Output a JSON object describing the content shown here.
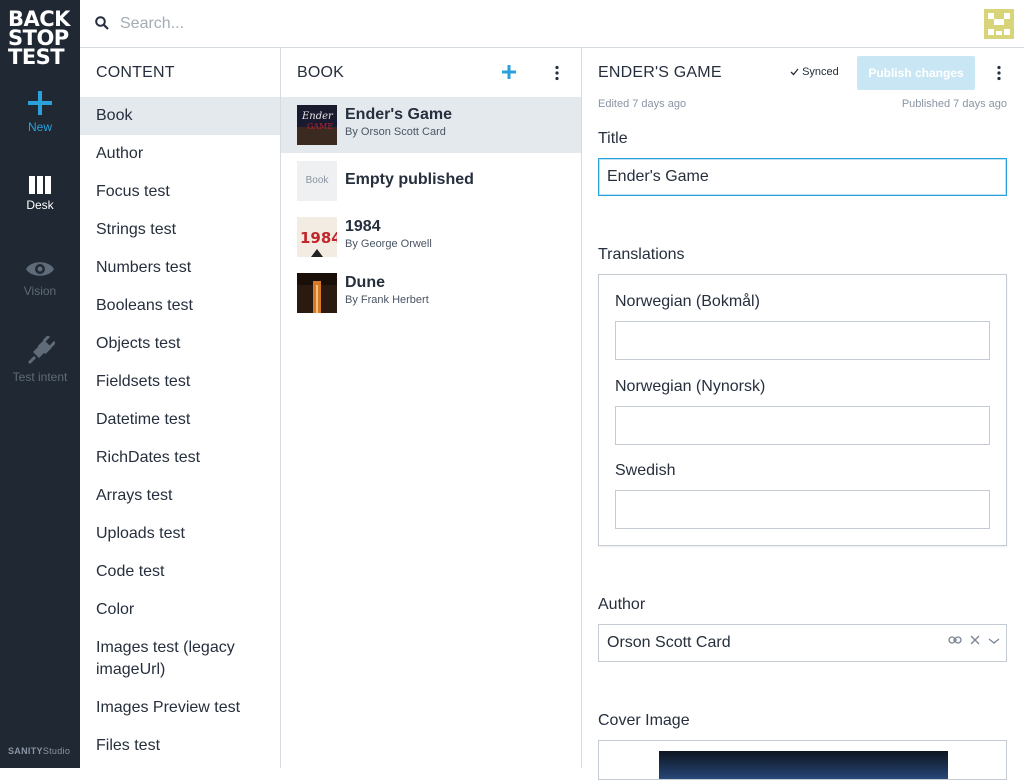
{
  "nav": {
    "logo": [
      "BACK",
      "STOP",
      "TEST"
    ],
    "items": [
      {
        "label": "New",
        "icon": "plus-icon"
      },
      {
        "label": "Desk",
        "icon": "columns-icon"
      },
      {
        "label": "Vision",
        "icon": "eye-icon"
      },
      {
        "label": "Test intent",
        "icon": "plug-icon"
      }
    ],
    "brand_bold": "SANITY",
    "brand_rest": "Studio"
  },
  "search": {
    "placeholder": "Search...",
    "icon": "search-icon"
  },
  "content_pane": {
    "title": "CONTENT",
    "items": [
      "Book",
      "Author",
      "Focus test",
      "Strings test",
      "Numbers test",
      "Booleans test",
      "Objects test",
      "Fieldsets test",
      "Datetime test",
      "RichDates test",
      "Arrays test",
      "Uploads test",
      "Code test",
      "Color",
      "Images test (legacy imageUrl)",
      "Images Preview test",
      "Files test"
    ],
    "active_index": 0
  },
  "book_pane": {
    "title": "BOOK",
    "items": [
      {
        "title": "Ender's Game",
        "subtitle": "By Orson Scott Card"
      },
      {
        "title": "Empty published",
        "subtitle": "",
        "thumb_text": "Book"
      },
      {
        "title": "1984",
        "subtitle": "By George Orwell",
        "thumb_text": "1984"
      },
      {
        "title": "Dune",
        "subtitle": "By Frank Herbert"
      }
    ]
  },
  "editor": {
    "title": "ENDER'S GAME",
    "synced": "Synced",
    "publish_label": "Publish changes",
    "edited": "Edited 7 days ago",
    "published": "Published 7 days ago",
    "fields": {
      "title_label": "Title",
      "title_value": "Ender's Game",
      "translations_label": "Translations",
      "translations": [
        "Norwegian (Bokmål)",
        "Norwegian (Nynorsk)",
        "Swedish"
      ],
      "author_label": "Author",
      "author_value": "Orson Scott Card",
      "cover_label": "Cover Image"
    }
  },
  "colors": {
    "accent": "#2aa1db",
    "nav_bg": "#1f2833",
    "selected_bg": "#e4e9ee"
  }
}
